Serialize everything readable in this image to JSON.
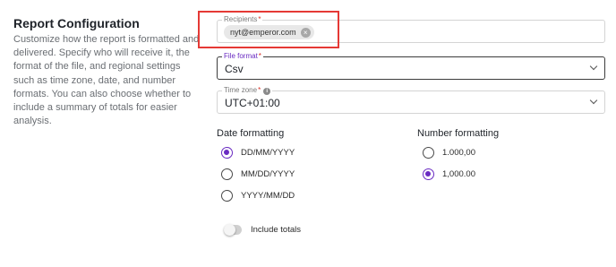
{
  "section": {
    "title": "Report Configuration",
    "description": "Customize how the report is formatted and delivered. Specify who will receive it, the format of the file, and regional settings such as time zone, date, and number formats. You can also choose whether to include a summary of totals for easier analysis."
  },
  "recipients": {
    "label": "Recipients",
    "required_mark": "*",
    "chips": [
      "nyt@emperor.com"
    ],
    "chip_remove_glyph": "×"
  },
  "file_format": {
    "label": "File format",
    "required_mark": "*",
    "value": "Csv"
  },
  "time_zone": {
    "label": "Time zone",
    "required_mark": "*",
    "info_glyph": "i",
    "value": "UTC+01:00"
  },
  "date_formatting": {
    "title": "Date formatting",
    "options": [
      {
        "label": "DD/MM/YYYY",
        "checked": true
      },
      {
        "label": "MM/DD/YYYY",
        "checked": false
      },
      {
        "label": "YYYY/MM/DD",
        "checked": false
      }
    ]
  },
  "number_formatting": {
    "title": "Number formatting",
    "options": [
      {
        "label": "1.000,00",
        "checked": false
      },
      {
        "label": "1,000.00",
        "checked": true
      }
    ]
  },
  "include_totals": {
    "label": "Include totals",
    "enabled": false
  },
  "colors": {
    "accent": "#6a2bc2",
    "highlight_border": "#e53935",
    "required": "#d93025"
  }
}
